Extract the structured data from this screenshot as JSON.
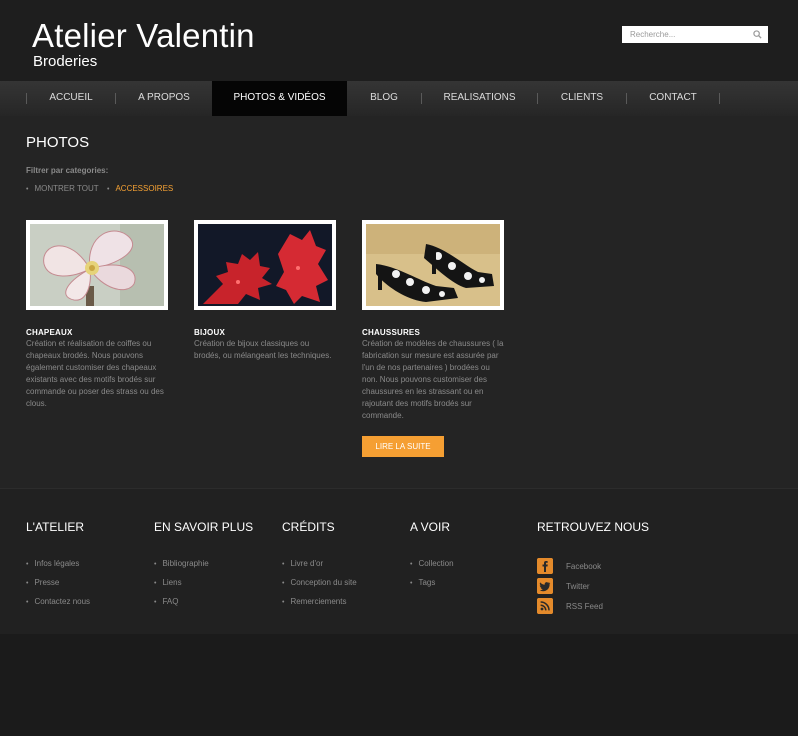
{
  "site": {
    "title": "Atelier Valentin",
    "subtitle": "Broderies"
  },
  "search": {
    "placeholder": "Recherche..."
  },
  "nav": {
    "items": [
      "ACCUEIL",
      "A PROPOS",
      "PHOTOS & VIDÉOS",
      "BLOG",
      "REALISATIONS",
      "CLIENTS",
      "CONTACT"
    ],
    "active": "PHOTOS & VIDÉOS"
  },
  "page": {
    "title": "PHOTOS",
    "filter_label": "Filtrer par categories:",
    "filters": [
      "MONTRER TOUT",
      "ACCESSOIRES"
    ],
    "active_filter": "ACCESSOIRES"
  },
  "cards": [
    {
      "title": "CHAPEAUX",
      "text": "Création et réalisation de coiffes ou chapeaux brodés. Nous pouvons également customiser des chapeaux existants avec des motifs brodés sur commande ou poser des strass ou des clous."
    },
    {
      "title": "BIJOUX",
      "text": "Création de bijoux classiques ou brodés, ou mélangeant les techniques."
    },
    {
      "title": "CHAUSSURES",
      "text": "Création de modèles de chaussures ( la fabrication sur mesure est assurée par l'un de nos partenaires ) brodées ou non. Nous pouvons customiser des chaussures en les strassant ou en rajoutant des motifs brodés sur commande."
    }
  ],
  "read_more": "LIRE LA SUITE",
  "footer": {
    "cols": [
      {
        "title": "L'ATELIER",
        "links": [
          "Infos légales",
          "Presse",
          "Contactez nous"
        ]
      },
      {
        "title": "EN SAVOIR PLUS",
        "links": [
          "Bibliographie",
          "Liens",
          "FAQ"
        ]
      },
      {
        "title": "CRÉDITS",
        "links": [
          "Livre d'or",
          "Conception du site",
          "Remerciements"
        ]
      },
      {
        "title": "A VOIR",
        "links": [
          "Collection",
          "Tags"
        ]
      }
    ],
    "social_title": "RETROUVEZ NOUS",
    "social": [
      {
        "label": "Facebook",
        "icon": "facebook-icon"
      },
      {
        "label": "Twitter",
        "icon": "twitter-icon"
      },
      {
        "label": "RSS Feed",
        "icon": "rss-icon"
      }
    ]
  },
  "colors": {
    "accent": "#f59f33",
    "nav_active_bg": "#050505"
  }
}
